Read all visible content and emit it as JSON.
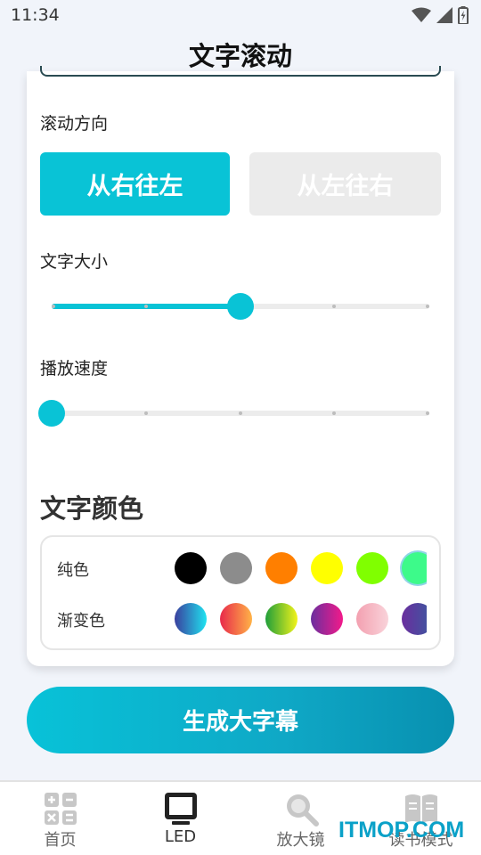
{
  "status_bar": {
    "time": "11:34"
  },
  "page": {
    "title": "文字滚动"
  },
  "direction": {
    "label": "滚动方向",
    "options": [
      "从右往左",
      "从左往右"
    ],
    "selected_index": 0
  },
  "text_size": {
    "label": "文字大小",
    "value_percent": 50,
    "steps": 4
  },
  "play_speed": {
    "label": "播放速度",
    "value_percent": 0,
    "steps": 4
  },
  "text_color": {
    "title": "文字颜色",
    "solid_label": "纯色",
    "gradient_label": "渐变色",
    "solid": [
      "#000000",
      "#8c8c8c",
      "#ff7f00",
      "#ffff00",
      "#80ff00",
      "#3dfa8a",
      "#00ffc8"
    ],
    "solid_selected_index": 5,
    "gradients": [
      [
        "#3a3f9e",
        "#1fe3f0"
      ],
      [
        "#e8294a",
        "#ffb347"
      ],
      [
        "#1f9e3a",
        "#f3f31a"
      ],
      [
        "#6a2e9e",
        "#f31a8a"
      ],
      [
        "#f3a0b0",
        "#f9d3da"
      ],
      [
        "#6a2e9e",
        "#3a5aa0"
      ],
      [
        "#0aa0a8",
        "#2fd8d0"
      ]
    ]
  },
  "generate_button": {
    "label": "生成大字幕"
  },
  "bottom_nav": {
    "items": [
      {
        "label": "首页",
        "icon": "calculator-icon"
      },
      {
        "label": "LED",
        "icon": "monitor-icon"
      },
      {
        "label": "放大镜",
        "icon": "magnifier-icon"
      },
      {
        "label": "读书模式",
        "icon": "book-icon"
      }
    ],
    "active_index": 1
  },
  "watermark": {
    "text": "ITMOP.COM"
  }
}
